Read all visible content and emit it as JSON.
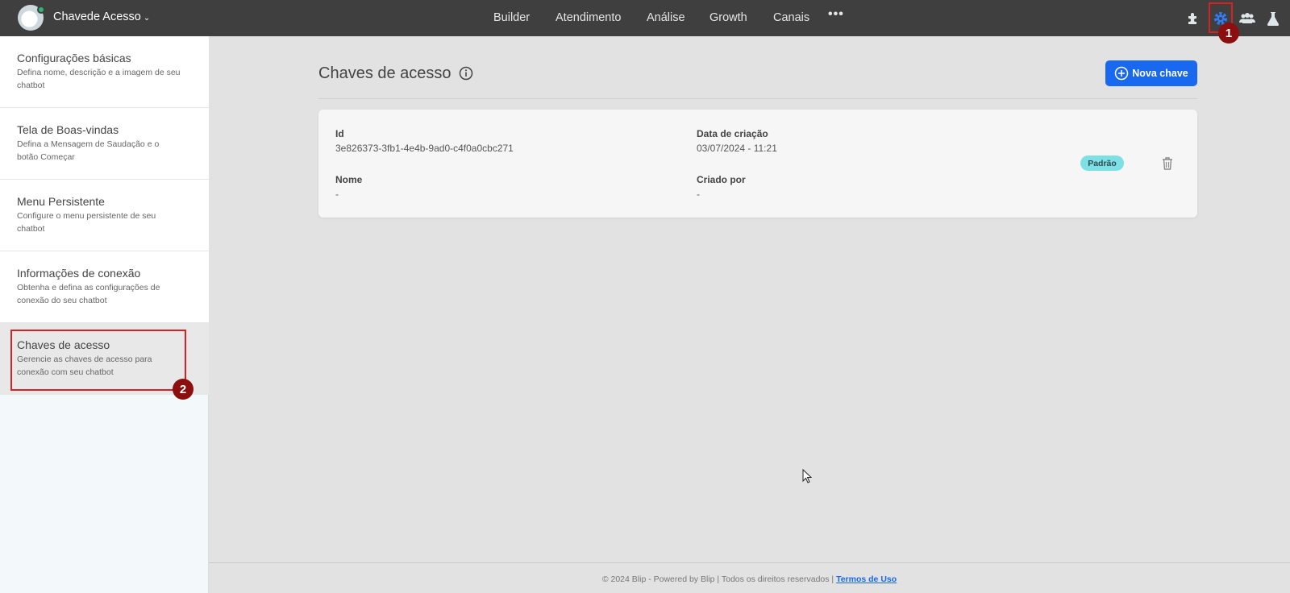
{
  "header": {
    "bot_name": "Chavede Acesso",
    "nav": [
      "Builder",
      "Atendimento",
      "Análise",
      "Growth",
      "Canais"
    ],
    "more": "•••",
    "icons": [
      "puzzle-icon",
      "gear-icon",
      "users-icon",
      "flask-icon"
    ],
    "annotation_1": "1"
  },
  "sidebar": {
    "items": [
      {
        "title": "Configurações básicas",
        "desc": "Defina nome, descrição e a imagem de seu chatbot"
      },
      {
        "title": "Tela de Boas-vindas",
        "desc": "Defina a Mensagem de Saudação e o botão Começar"
      },
      {
        "title": "Menu Persistente",
        "desc": "Configure o menu persistente de seu chatbot"
      },
      {
        "title": "Informações de conexão",
        "desc": "Obtenha e defina as configurações de conexão do seu chatbot"
      },
      {
        "title": "Chaves de acesso",
        "desc": "Gerencie as chaves de acesso para conexão com seu chatbot"
      }
    ],
    "annotation_2": "2"
  },
  "main": {
    "title": "Chaves de acesso",
    "new_key_label": "Nova chave",
    "card": {
      "id_label": "Id",
      "id_value": "3e826373-3fb1-4e4b-9ad0-c4f0a0cbc271",
      "created_label": "Data de criação",
      "created_value": "03/07/2024 - 11:21",
      "name_label": "Nome",
      "name_value": "-",
      "creator_label": "Criado por",
      "creator_value": "-",
      "badge": "Padrão"
    }
  },
  "footer": {
    "text": "© 2024 Blip - Powered by Blip | Todos os direitos reservados |",
    "link": "Termos de Uso"
  },
  "colors": {
    "topbar": "#3f3f3f",
    "accent": "#1968f0",
    "badge": "#7ee0e4",
    "highlight": "#d62222"
  }
}
